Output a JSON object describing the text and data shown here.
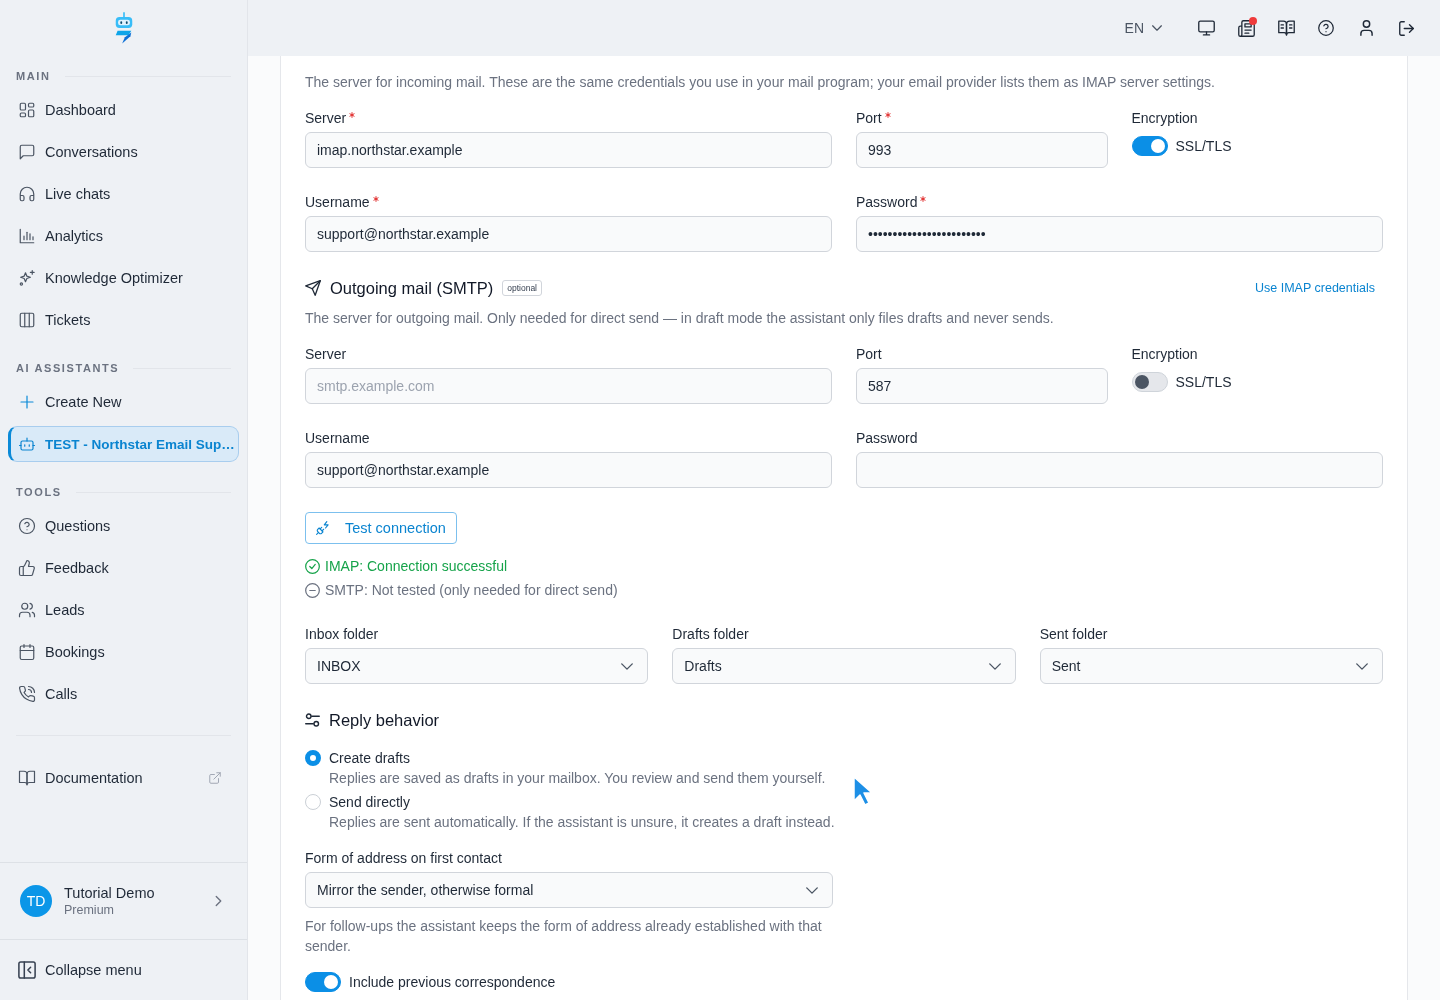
{
  "header": {
    "language": "EN",
    "notification_dot": true
  },
  "sidebar": {
    "sections": [
      {
        "title": "MAIN",
        "items": [
          {
            "label": "Dashboard",
            "selected": false
          },
          {
            "label": "Conversations",
            "selected": false
          },
          {
            "label": "Live chats",
            "selected": false
          },
          {
            "label": "Analytics",
            "selected": false
          },
          {
            "label": "Knowledge Optimizer",
            "selected": false
          },
          {
            "label": "Tickets",
            "selected": false
          }
        ]
      },
      {
        "title": "AI ASSISTANTS",
        "items": [
          {
            "label": "Create New",
            "selected": false
          },
          {
            "label": "TEST - Northstar Email Sup…",
            "selected": true
          }
        ]
      },
      {
        "title": "TOOLS",
        "items": [
          {
            "label": "Questions",
            "selected": false
          },
          {
            "label": "Feedback",
            "selected": false
          },
          {
            "label": "Leads",
            "selected": false
          },
          {
            "label": "Bookings",
            "selected": false
          },
          {
            "label": "Calls",
            "selected": false
          }
        ]
      }
    ],
    "documentation": "Documentation",
    "user": {
      "initials": "TD",
      "name": "Tutorial Demo",
      "plan": "Premium"
    },
    "collapse": "Collapse menu"
  },
  "incoming": {
    "description": "The server for incoming mail. These are the same credentials you use in your mail program; your email provider lists them as IMAP server settings.",
    "server": {
      "label": "Server",
      "required": true,
      "value": "imap.northstar.example"
    },
    "port": {
      "label": "Port",
      "required": true,
      "value": "993"
    },
    "encryption": {
      "label": "Encryption",
      "toggle_label": "SSL/TLS",
      "on": true
    },
    "username": {
      "label": "Username",
      "required": true,
      "value": "support@northstar.example"
    },
    "password": {
      "label": "Password",
      "required": true,
      "value": "••••••••••••••••••••••••"
    }
  },
  "outgoing": {
    "title": "Outgoing mail (SMTP)",
    "badge": "optional",
    "link": "Use IMAP credentials",
    "description": "The server for outgoing mail. Only needed for direct send — in draft mode the assistant only files drafts and never sends.",
    "server": {
      "label": "Server",
      "required": false,
      "placeholder": "smtp.example.com"
    },
    "port": {
      "label": "Port",
      "required": false,
      "value": "587"
    },
    "encryption": {
      "label": "Encryption",
      "toggle_label": "SSL/TLS",
      "on": false
    },
    "username": {
      "label": "Username",
      "required": false,
      "value": "support@northstar.example"
    },
    "password": {
      "label": "Password",
      "required": false
    }
  },
  "test_button": "Test connection",
  "status": [
    {
      "kind": "success",
      "text": "IMAP: Connection successful"
    },
    {
      "kind": "neutral",
      "text": "SMTP: Not tested (only needed for direct send)"
    }
  ],
  "folders": [
    {
      "label": "Inbox folder",
      "value": "INBOX"
    },
    {
      "label": "Drafts folder",
      "value": "Drafts"
    },
    {
      "label": "Sent folder",
      "value": "Sent"
    }
  ],
  "reply_behavior": {
    "title": "Reply behavior",
    "options": [
      {
        "label": "Create drafts",
        "description": "Replies are saved as drafts in your mailbox. You review and send them yourself.",
        "selected": true
      },
      {
        "label": "Send directly",
        "description": "Replies are sent automatically. If the assistant is unsure, it creates a draft instead.",
        "selected": false
      }
    ],
    "address": {
      "label": "Form of address on first contact",
      "value": "Mirror the sender, otherwise formal",
      "help": "For follow-ups the assistant keeps the form of address already established with that sender."
    },
    "history": {
      "label": "Include previous correspondence",
      "on": true
    }
  }
}
